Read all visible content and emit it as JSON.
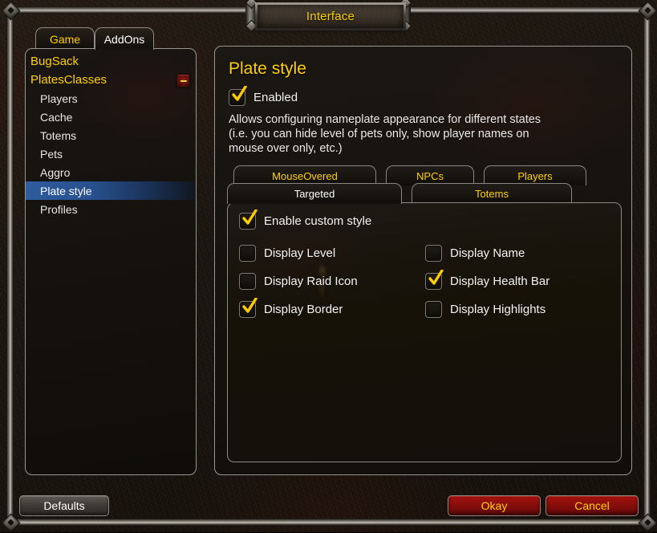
{
  "window": {
    "title": "Interface"
  },
  "outer_tabs": [
    {
      "label": "Game",
      "active": false
    },
    {
      "label": "AddOns",
      "active": true
    }
  ],
  "sidebar": {
    "items": [
      {
        "label": "BugSack",
        "type": "addon",
        "selected": false,
        "collapse": false
      },
      {
        "label": "PlatesClasses",
        "type": "addon",
        "selected": false,
        "collapse": true
      },
      {
        "label": "Players",
        "type": "child",
        "selected": false,
        "collapse": false
      },
      {
        "label": "Cache",
        "type": "child",
        "selected": false,
        "collapse": false
      },
      {
        "label": "Totems",
        "type": "child",
        "selected": false,
        "collapse": false
      },
      {
        "label": "Pets",
        "type": "child",
        "selected": false,
        "collapse": false
      },
      {
        "label": "Aggro",
        "type": "child",
        "selected": false,
        "collapse": false
      },
      {
        "label": "Plate style",
        "type": "child",
        "selected": true,
        "collapse": false
      },
      {
        "label": "Profiles",
        "type": "child",
        "selected": false,
        "collapse": false
      }
    ]
  },
  "main": {
    "title": "Plate style",
    "enabled": {
      "label": "Enabled",
      "checked": true
    },
    "description": "Allows configuring nameplate appearance for different states (i.e. you can hide level of pets only, show player names on mouse over only, etc.)",
    "inner_tabs": [
      {
        "label": "MouseOvered",
        "active": false
      },
      {
        "label": "NPCs",
        "active": false
      },
      {
        "label": "Players",
        "active": false
      },
      {
        "label": "Targeted",
        "active": true
      },
      {
        "label": "Totems",
        "active": false
      }
    ],
    "enable_custom_style": {
      "label": "Enable custom style",
      "checked": true
    },
    "options": [
      {
        "label": "Display Level",
        "checked": false
      },
      {
        "label": "Display Name",
        "checked": false
      },
      {
        "label": "Display Raid Icon",
        "checked": false
      },
      {
        "label": "Display Health Bar",
        "checked": true
      },
      {
        "label": "Display Border",
        "checked": true
      },
      {
        "label": "Display Highlights",
        "checked": false
      }
    ]
  },
  "footer": {
    "defaults_label": "Defaults",
    "okay_label": "Okay",
    "cancel_label": "Cancel"
  },
  "colors": {
    "accent_yellow": "#ffd100",
    "active_white": "#ffffff",
    "selection_blue": "#2f5c9e",
    "button_red": "#a3120f",
    "frame_metal": "#8a857c"
  }
}
